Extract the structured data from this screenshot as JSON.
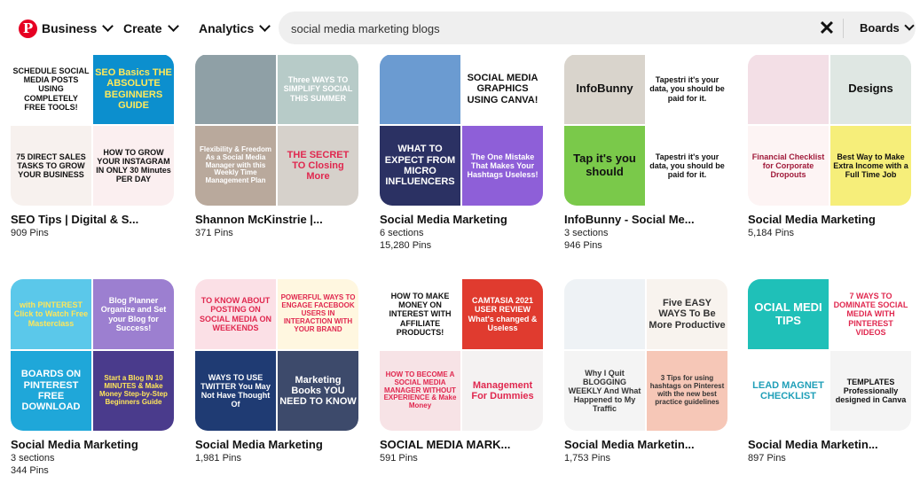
{
  "nav": {
    "business": "Business",
    "create": "Create",
    "analytics": "Analytics"
  },
  "search": {
    "value": "social media marketing blogs",
    "filter": "Boards"
  },
  "icons": {
    "logo": "P",
    "clear": "✕"
  },
  "boards": [
    {
      "title": "SEO Tips | Digital & S...",
      "sections": "",
      "pins": "909 Pins",
      "tiles": [
        {
          "text": "SCHEDULE SOCIAL MEDIA POSTS USING COMPLETELY FREE TOOLS!",
          "bg": "#ffffff",
          "fg": "#111111"
        },
        {
          "text": "SEO Basics THE ABSOLUTE BEGINNERS GUIDE",
          "bg": "#0c8fce",
          "fg": "#ffe95a"
        },
        {
          "text": "75 DIRECT SALES TASKS TO GROW YOUR BUSINESS",
          "bg": "#f7f1ee",
          "fg": "#111111"
        },
        {
          "text": "HOW TO GROW YOUR INSTAGRAM IN ONLY 30 Minutes PER DAY",
          "bg": "#fbeff0",
          "fg": "#111111"
        }
      ]
    },
    {
      "title": "Shannon McKinstrie |...",
      "sections": "",
      "pins": "371 Pins",
      "tiles": [
        {
          "text": "",
          "bg": "#8fa0a6",
          "fg": "#ffffff"
        },
        {
          "text": "Three WAYS TO SIMPLIFY SOCIAL THIS SUMMER",
          "bg": "#b7cbc8",
          "fg": "#ffffff"
        },
        {
          "text": "Flexibility & Freedom As a Social Media Manager with this Weekly Time Management Plan",
          "bg": "#b9a99c",
          "fg": "#ffffff"
        },
        {
          "text": "THE SECRET TO Closing More",
          "bg": "#d6d1cb",
          "fg": "#e0284f"
        }
      ]
    },
    {
      "title": "Social Media Marketing",
      "sections": "6 sections",
      "pins": "15,280 Pins",
      "tiles": [
        {
          "text": "",
          "bg": "#6b9bd1",
          "fg": "#ffffff"
        },
        {
          "text": "SOCIAL MEDIA GRAPHICS USING CANVA!",
          "bg": "#ffffff",
          "fg": "#111111"
        },
        {
          "text": "WHAT TO EXPECT FROM MICRO INFLUENCERS",
          "bg": "#2b3163",
          "fg": "#ffffff"
        },
        {
          "text": "The One Mistake That Makes Your Hashtags Useless!",
          "bg": "#8e5fd8",
          "fg": "#ffffff"
        }
      ]
    },
    {
      "title": "InfoBunny - Social Me...",
      "sections": "3 sections",
      "pins": "946 Pins",
      "tiles": [
        {
          "text": "InfoBunny",
          "bg": "#d9d4cc",
          "fg": "#111111"
        },
        {
          "text": "Tapestri it's your data, you should be paid for it.",
          "bg": "#ffffff",
          "fg": "#111111"
        },
        {
          "text": "Tap it's you should",
          "bg": "#7ac94a",
          "fg": "#111111"
        },
        {
          "text": "Tapestri it's your data, you should be paid for it.",
          "bg": "#ffffff",
          "fg": "#111111"
        }
      ]
    },
    {
      "title": "Social Media Marketing",
      "sections": "",
      "pins": "5,184 Pins",
      "tiles": [
        {
          "text": "",
          "bg": "#f3dfe6",
          "fg": "#111111"
        },
        {
          "text": "Designs",
          "bg": "#dfe7e3",
          "fg": "#111111"
        },
        {
          "text": "Financial Checklist for Corporate Dropouts",
          "bg": "#fdf4f4",
          "fg": "#a01a3a"
        },
        {
          "text": "Best Way to Make Extra Income with a Full Time Job",
          "bg": "#f6ee7a",
          "fg": "#111111"
        }
      ]
    },
    {
      "title": "Social Media Marketing",
      "sections": "3 sections",
      "pins": "344 Pins",
      "tiles": [
        {
          "text": "with PINTEREST Click to Watch Free Masterclass",
          "bg": "#5bc8ea",
          "fg": "#ffe65a"
        },
        {
          "text": "Blog Planner Organize and Set your Blog for Success!",
          "bg": "#9c7fd0",
          "fg": "#ffffff"
        },
        {
          "text": "BOARDS ON PINTEREST FREE DOWNLOAD",
          "bg": "#1fa7d9",
          "fg": "#ffffff"
        },
        {
          "text": "Start a Blog IN 10 MINUTES & Make Money Step-by-Step Beginners Guide",
          "bg": "#4a3b8c",
          "fg": "#ffe65a"
        }
      ]
    },
    {
      "title": "Social Media Marketing",
      "sections": "",
      "pins": "1,981 Pins",
      "tiles": [
        {
          "text": "TO KNOW ABOUT POSTING ON SOCIAL MEDIA ON WEEKENDS",
          "bg": "#fbe0e6",
          "fg": "#e0284f"
        },
        {
          "text": "POWERFUL WAYS TO ENGAGE FACEBOOK USERS IN INTERACTION WITH YOUR BRAND",
          "bg": "#fff7e0",
          "fg": "#e0284f"
        },
        {
          "text": "WAYS TO USE TWITTER You May Not Have Thought Of",
          "bg": "#1f3b73",
          "fg": "#ffffff"
        },
        {
          "text": "Marketing Books YOU NEED TO KNOW",
          "bg": "#3d4a6b",
          "fg": "#ffffff"
        }
      ]
    },
    {
      "title": "SOCIAL MEDIA MARK...",
      "sections": "",
      "pins": "591 Pins",
      "tiles": [
        {
          "text": "HOW TO MAKE MONEY ON INTEREST WITH AFFILIATE PRODUCTS!",
          "bg": "#ffffff",
          "fg": "#111111"
        },
        {
          "text": "CAMTASIA 2021 USER REVIEW What's changed & Useless",
          "bg": "#e03b2f",
          "fg": "#ffffff"
        },
        {
          "text": "HOW TO BECOME A SOCIAL MEDIA MANAGER WITHOUT EXPERIENCE & Make Money",
          "bg": "#f7e3e6",
          "fg": "#e0284f"
        },
        {
          "text": "Management For Dummies",
          "bg": "#f4f2f2",
          "fg": "#e0284f"
        }
      ]
    },
    {
      "title": "Social Media Marketin...",
      "sections": "",
      "pins": "1,753 Pins",
      "tiles": [
        {
          "text": "",
          "bg": "#eef2f5",
          "fg": "#111111"
        },
        {
          "text": "Five EASY WAYS To Be More Productive",
          "bg": "#f8f3ee",
          "fg": "#333333"
        },
        {
          "text": "Why I Quit BLOGGING WEEKLY And What Happened to My Traffic",
          "bg": "#f4f4f4",
          "fg": "#333333"
        },
        {
          "text": "3 Tips for using hashtags on Pinterest with the new best practice guidelines",
          "bg": "#f6c7b7",
          "fg": "#333333"
        }
      ]
    },
    {
      "title": "Social Media Marketin...",
      "sections": "",
      "pins": "897 Pins",
      "tiles": [
        {
          "text": "OCIAL MEDI TIPS",
          "bg": "#1fc0b8",
          "fg": "#ffffff"
        },
        {
          "text": "7 WAYS TO DOMINATE SOCIAL MEDIA WITH PINTEREST VIDEOS",
          "bg": "#ffffff",
          "fg": "#e0284f"
        },
        {
          "text": "LEAD MAGNET CHECKLIST",
          "bg": "#ffffff",
          "fg": "#1f9fb8"
        },
        {
          "text": "TEMPLATES Professionally designed in Canva",
          "bg": "#f4f4f4",
          "fg": "#111111"
        }
      ]
    }
  ]
}
